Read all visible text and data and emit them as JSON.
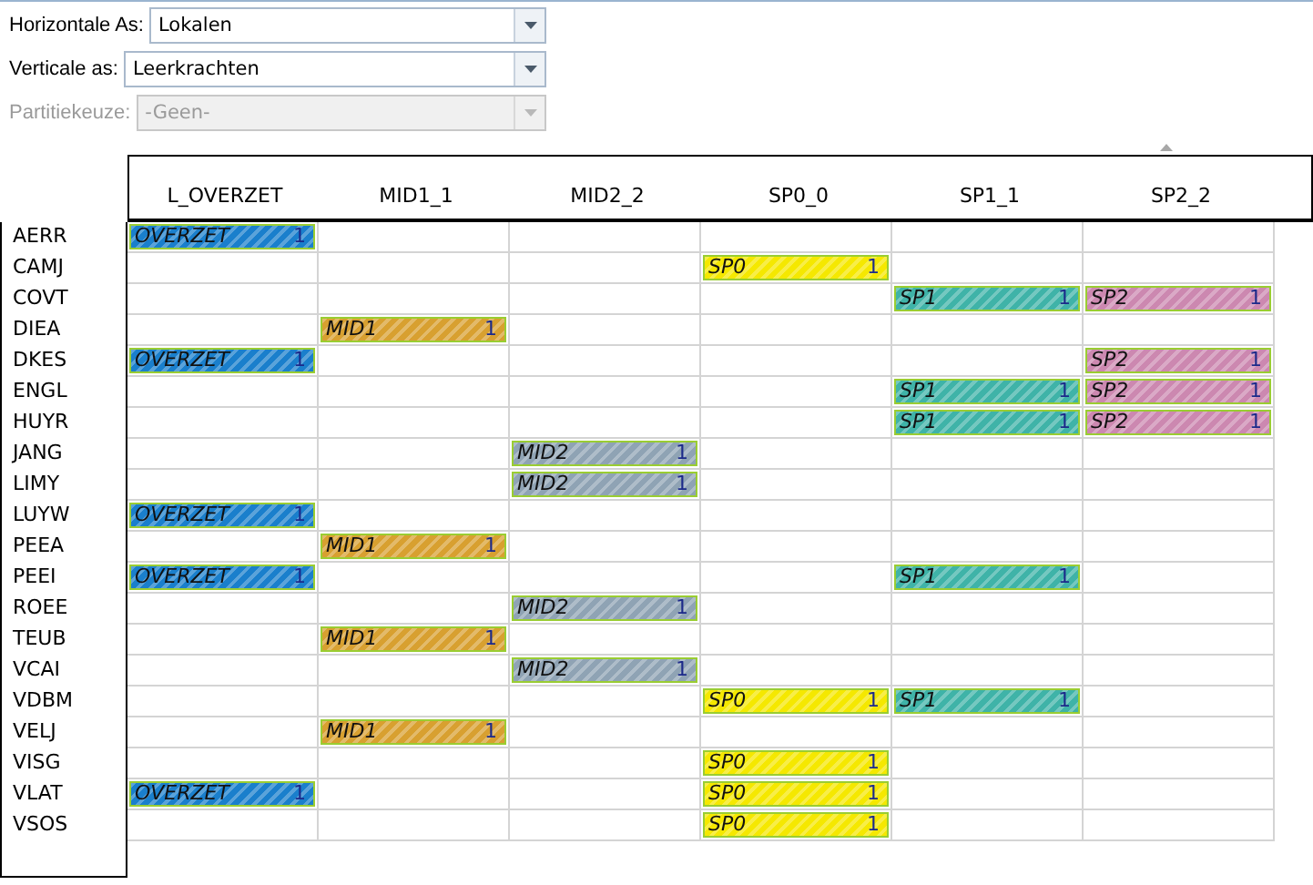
{
  "filters": [
    {
      "label": "Horizontale As:",
      "value": "Lokalen",
      "disabled": false
    },
    {
      "label": "Verticale as:",
      "value": "Leerkrachten",
      "disabled": false
    },
    {
      "label": "Partitiekeuze:",
      "value": "-Geen-",
      "disabled": true
    }
  ],
  "table": {
    "columns": [
      "L_OVERZET",
      "MID1_1",
      "MID2_2",
      "SP0_0",
      "SP1_1",
      "SP2_2"
    ],
    "rows": [
      {
        "name": "AERR",
        "cells": [
          {
            "kind": "block",
            "label": "OVERZET",
            "count": "1",
            "color": "#1a7fcc"
          },
          {
            "kind": "empty"
          },
          {
            "kind": "empty"
          },
          {
            "kind": "empty"
          },
          {
            "kind": "empty"
          },
          {
            "kind": "empty"
          }
        ]
      },
      {
        "name": "CAMJ",
        "cells": [
          {
            "kind": "empty"
          },
          {
            "kind": "empty"
          },
          {
            "kind": "empty"
          },
          {
            "kind": "block",
            "label": "SP0",
            "count": "1",
            "color": "#f5e800"
          },
          {
            "kind": "empty"
          },
          {
            "kind": "empty"
          }
        ]
      },
      {
        "name": "COVT",
        "cells": [
          {
            "kind": "empty"
          },
          {
            "kind": "empty"
          },
          {
            "kind": "empty"
          },
          {
            "kind": "empty"
          },
          {
            "kind": "block",
            "label": "SP1",
            "count": "1",
            "color": "#3fb3a8"
          },
          {
            "kind": "block",
            "label": "SP2",
            "count": "1",
            "color": "#cc88b0"
          }
        ]
      },
      {
        "name": "DIEA",
        "cells": [
          {
            "kind": "empty"
          },
          {
            "kind": "block",
            "label": "MID1",
            "count": "1",
            "color": "#d8a030"
          },
          {
            "kind": "empty"
          },
          {
            "kind": "empty"
          },
          {
            "kind": "empty"
          },
          {
            "kind": "empty"
          }
        ]
      },
      {
        "name": "DKES",
        "cells": [
          {
            "kind": "block",
            "label": "OVERZET",
            "count": "1",
            "color": "#1a7fcc"
          },
          {
            "kind": "empty"
          },
          {
            "kind": "empty"
          },
          {
            "kind": "empty"
          },
          {
            "kind": "empty"
          },
          {
            "kind": "block",
            "label": "SP2",
            "count": "1",
            "color": "#cc88b0"
          }
        ]
      },
      {
        "name": "ENGL",
        "cells": [
          {
            "kind": "empty"
          },
          {
            "kind": "empty"
          },
          {
            "kind": "empty"
          },
          {
            "kind": "empty"
          },
          {
            "kind": "block",
            "label": "SP1",
            "count": "1",
            "color": "#3fb3a8"
          },
          {
            "kind": "block",
            "label": "SP2",
            "count": "1",
            "color": "#cc88b0"
          }
        ]
      },
      {
        "name": "HUYR",
        "cells": [
          {
            "kind": "empty"
          },
          {
            "kind": "empty"
          },
          {
            "kind": "empty"
          },
          {
            "kind": "empty"
          },
          {
            "kind": "block",
            "label": "SP1",
            "count": "1",
            "color": "#3fb3a8"
          },
          {
            "kind": "block",
            "label": "SP2",
            "count": "1",
            "color": "#cc88b0"
          }
        ]
      },
      {
        "name": "JANG",
        "cells": [
          {
            "kind": "empty"
          },
          {
            "kind": "empty"
          },
          {
            "kind": "block",
            "label": "MID2",
            "count": "1",
            "color": "#8fa3b4"
          },
          {
            "kind": "empty"
          },
          {
            "kind": "empty"
          },
          {
            "kind": "empty"
          }
        ]
      },
      {
        "name": "LIMY",
        "cells": [
          {
            "kind": "empty"
          },
          {
            "kind": "empty"
          },
          {
            "kind": "block",
            "label": "MID2",
            "count": "1",
            "color": "#8fa3b4"
          },
          {
            "kind": "empty"
          },
          {
            "kind": "empty"
          },
          {
            "kind": "empty"
          }
        ]
      },
      {
        "name": "LUYW",
        "cells": [
          {
            "kind": "block",
            "label": "OVERZET",
            "count": "1",
            "color": "#1a7fcc"
          },
          {
            "kind": "empty"
          },
          {
            "kind": "empty"
          },
          {
            "kind": "empty"
          },
          {
            "kind": "empty"
          },
          {
            "kind": "empty"
          }
        ]
      },
      {
        "name": "PEEA",
        "cells": [
          {
            "kind": "empty"
          },
          {
            "kind": "block",
            "label": "MID1",
            "count": "1",
            "color": "#d8a030"
          },
          {
            "kind": "empty"
          },
          {
            "kind": "empty"
          },
          {
            "kind": "empty"
          },
          {
            "kind": "empty"
          }
        ]
      },
      {
        "name": "PEEI",
        "cells": [
          {
            "kind": "block",
            "label": "OVERZET",
            "count": "1",
            "color": "#1a7fcc"
          },
          {
            "kind": "empty"
          },
          {
            "kind": "empty"
          },
          {
            "kind": "empty"
          },
          {
            "kind": "block",
            "label": "SP1",
            "count": "1",
            "color": "#3fb3a8"
          },
          {
            "kind": "empty"
          }
        ]
      },
      {
        "name": "ROEE",
        "cells": [
          {
            "kind": "empty"
          },
          {
            "kind": "empty"
          },
          {
            "kind": "block",
            "label": "MID2",
            "count": "1",
            "color": "#8fa3b4"
          },
          {
            "kind": "empty"
          },
          {
            "kind": "empty"
          },
          {
            "kind": "empty"
          }
        ]
      },
      {
        "name": "TEUB",
        "cells": [
          {
            "kind": "empty"
          },
          {
            "kind": "block",
            "label": "MID1",
            "count": "1",
            "color": "#d8a030"
          },
          {
            "kind": "empty"
          },
          {
            "kind": "empty"
          },
          {
            "kind": "empty"
          },
          {
            "kind": "empty"
          }
        ]
      },
      {
        "name": "VCAI",
        "cells": [
          {
            "kind": "empty"
          },
          {
            "kind": "empty"
          },
          {
            "kind": "block",
            "label": "MID2",
            "count": "1",
            "color": "#8fa3b4"
          },
          {
            "kind": "empty"
          },
          {
            "kind": "empty"
          },
          {
            "kind": "empty"
          }
        ]
      },
      {
        "name": "VDBM",
        "cells": [
          {
            "kind": "empty"
          },
          {
            "kind": "empty"
          },
          {
            "kind": "empty"
          },
          {
            "kind": "block",
            "label": "SP0",
            "count": "1",
            "color": "#f5e800"
          },
          {
            "kind": "block",
            "label": "SP1",
            "count": "1",
            "color": "#3fb3a8"
          },
          {
            "kind": "empty"
          }
        ]
      },
      {
        "name": "VELJ",
        "cells": [
          {
            "kind": "empty"
          },
          {
            "kind": "block",
            "label": "MID1",
            "count": "1",
            "color": "#d8a030"
          },
          {
            "kind": "empty"
          },
          {
            "kind": "empty"
          },
          {
            "kind": "empty"
          },
          {
            "kind": "empty"
          }
        ]
      },
      {
        "name": "VISG",
        "cells": [
          {
            "kind": "empty"
          },
          {
            "kind": "empty"
          },
          {
            "kind": "empty"
          },
          {
            "kind": "block",
            "label": "SP0",
            "count": "1",
            "color": "#f5e800"
          },
          {
            "kind": "empty"
          },
          {
            "kind": "empty"
          }
        ]
      },
      {
        "name": "VLAT",
        "cells": [
          {
            "kind": "block",
            "label": "OVERZET",
            "count": "1",
            "color": "#1a7fcc"
          },
          {
            "kind": "empty"
          },
          {
            "kind": "empty"
          },
          {
            "kind": "block",
            "label": "SP0",
            "count": "1",
            "color": "#f5e800"
          },
          {
            "kind": "empty"
          },
          {
            "kind": "empty"
          }
        ]
      },
      {
        "name": "VSOS",
        "cells": [
          {
            "kind": "empty"
          },
          {
            "kind": "empty"
          },
          {
            "kind": "empty"
          },
          {
            "kind": "block",
            "label": "SP0",
            "count": "1",
            "color": "#f5e800"
          },
          {
            "kind": "empty"
          },
          {
            "kind": "empty"
          }
        ]
      }
    ]
  }
}
